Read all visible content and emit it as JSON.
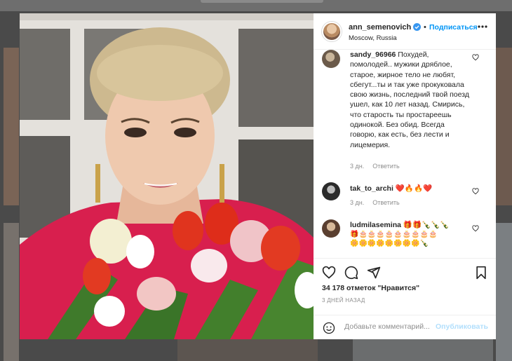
{
  "header": {
    "username": "ann_semenovich",
    "dot": "•",
    "follow_label": "Подписаться",
    "location": "Moscow, Russia"
  },
  "comments": [
    {
      "username": "sandy_96966",
      "text": " Похудей, помолодей.. мужики дряблое, старое, жирное тело не любят, сбегут...ты и так уже прокуковала свою жизнь, последний твой поезд ушел, как 10 лет назад. Смирись, что старость ты простареешь одинокой. Без обид. Всегда говорю, как есть, без лести и лицемерия.",
      "time": "3 дн.",
      "reply_label": "Ответить"
    },
    {
      "username": "tak_to_archi",
      "text": " ❤️🔥🔥❤️",
      "time": "3 дн.",
      "reply_label": "Ответить"
    },
    {
      "username": "ludmilasemina",
      "text": " 🎁🎁🍾🍾🍾",
      "emoji_line_2": "🎁🎂🎂🎂🎂🎂🎂🎂🎂🎂",
      "emoji_line_3": "🌼🌼🌼🌼🌼🌼🌼🌼🍾"
    }
  ],
  "actions": {
    "like_icon": "heart-icon",
    "comment_icon": "comment-icon",
    "share_icon": "share-icon",
    "save_icon": "bookmark-icon"
  },
  "likes_text": "34 178 отметок \"Нравится\"",
  "time_ago": "3 ДНЕЙ НАЗАД",
  "add_comment": {
    "placeholder": "Добавьте комментарий...",
    "publish_label": "Опубликовать"
  }
}
